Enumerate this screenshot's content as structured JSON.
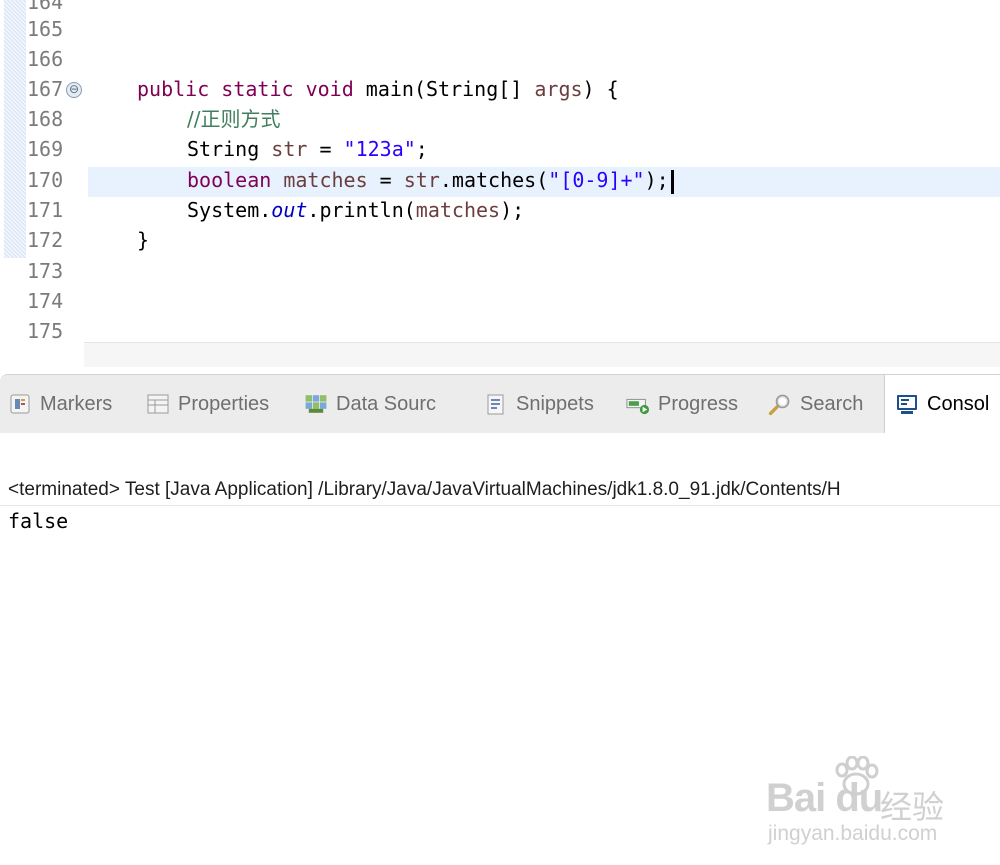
{
  "editor": {
    "line_numbers": [
      "164",
      "165",
      "166",
      "167",
      "168",
      "169",
      "170",
      "171",
      "172",
      "173",
      "174",
      "175"
    ],
    "fold_symbol": "⊖",
    "code": {
      "line167": {
        "kw1": "public static void ",
        "plain1": "main(String[] ",
        "var1": "args",
        "plain2": ") {"
      },
      "line168": {
        "comment": "//正则方式"
      },
      "line169": {
        "plain1": "String ",
        "var1": "str",
        "plain2": " = ",
        "str1": "\"123a\"",
        "plain3": ";"
      },
      "line170": {
        "kw1": "boolean ",
        "var1": "matches",
        "plain1": " = ",
        "var2": "str",
        "plain2": ".matches(",
        "str1": "\"[0-9]+\"",
        "plain3": ");"
      },
      "line171": {
        "plain1": "System.",
        "field1": "out",
        "plain2": ".println(",
        "var1": "matches",
        "plain3": ");"
      },
      "line172": {
        "plain1": "}"
      }
    }
  },
  "tabs": [
    {
      "label": "Markers",
      "icon": "markers-icon"
    },
    {
      "label": "Properties",
      "icon": "properties-icon"
    },
    {
      "label": "Data Sourc",
      "icon": "data-source-icon"
    },
    {
      "label": "Snippets",
      "icon": "snippets-icon"
    },
    {
      "label": "Progress",
      "icon": "progress-icon"
    },
    {
      "label": "Search",
      "icon": "search-icon"
    },
    {
      "label": "Consol",
      "icon": "console-icon",
      "active": true
    }
  ],
  "console": {
    "header": "<terminated> Test [Java Application] /Library/Java/JavaVirtualMachines/jdk1.8.0_91.jdk/Contents/H",
    "output": "false"
  },
  "watermark": {
    "logo": "Bai du",
    "brand": "经验",
    "url": "jingyan.baidu.com"
  },
  "colors": {
    "keyword": "#7f0055",
    "local_variable": "#6a3e3e",
    "string": "#2a00ff",
    "comment": "#3f7f5f",
    "static_field": "#0000c0",
    "current_line": "#e8f2fe"
  }
}
